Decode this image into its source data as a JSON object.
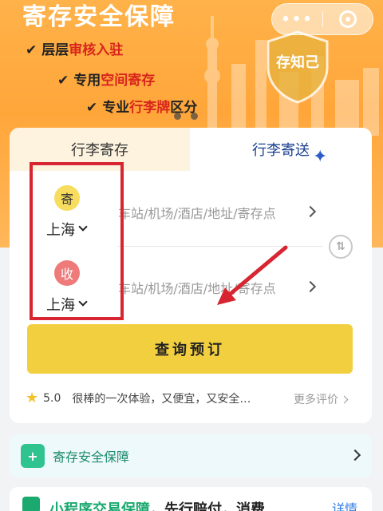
{
  "banner": {
    "title": "寄存安全保障",
    "features": [
      {
        "prefix": "层层",
        "highlight": "审核入驻",
        "suffix": ""
      },
      {
        "prefix": "专用",
        "highlight": "空间寄存",
        "suffix": ""
      },
      {
        "prefix": "专业",
        "highlight": "行李牌",
        "suffix": "区分"
      }
    ],
    "shield_text": "存知己",
    "capsule_more": "•••"
  },
  "tabs": [
    {
      "label": "行李寄存",
      "active": false
    },
    {
      "label": "行李寄送",
      "active": true
    }
  ],
  "sender": {
    "badge": "寄",
    "city": "上海",
    "address_placeholder": "车站/机场/酒店/地址/寄存点"
  },
  "receiver": {
    "badge": "收",
    "city": "上海",
    "address_placeholder": "车站/机场/酒店/地址/寄存点"
  },
  "swap_symbol": "⇅",
  "query_button": "查询预订",
  "rating": {
    "score": "5.0",
    "review": "很棒的一次体验，又便宜，又安全…",
    "more": "更多评价"
  },
  "guarantee": {
    "label": "寄存安全保障"
  },
  "bottom": {
    "highlight": "小程序交易保障",
    "rest": "，先行赔付，消费",
    "detail": "详情"
  },
  "colors": {
    "accent_yellow": "#f2cf3f",
    "highlight_red": "#d72631",
    "tab_blue": "#1a3f8f",
    "green": "#1aa96e"
  }
}
